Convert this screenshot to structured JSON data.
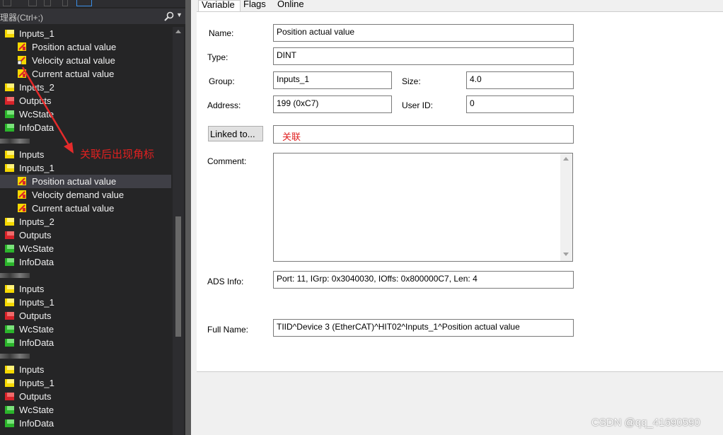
{
  "search": {
    "placeholder": "理器(Ctrl+;)"
  },
  "tree": [
    {
      "label": "Inputs_1",
      "icon": "yellow-folder-icon",
      "indent": 0
    },
    {
      "label": "Position actual value",
      "icon": "input-variable-icon",
      "indent": 1
    },
    {
      "label": "Velocity actual value",
      "icon": "linked-input-variable-icon",
      "indent": 1
    },
    {
      "label": "Current actual value",
      "icon": "input-variable-icon",
      "indent": 1
    },
    {
      "label": "Inputs_2",
      "icon": "yellow-folder-icon",
      "indent": 0
    },
    {
      "label": "Outputs",
      "icon": "red-folder-icon",
      "indent": 0
    },
    {
      "label": "WcState",
      "icon": "green-folder-icon",
      "indent": 0
    },
    {
      "label": "InfoData",
      "icon": "green-folder-icon",
      "indent": 0
    },
    {
      "label": "",
      "icon": "device-icon",
      "indent": -1
    },
    {
      "label": "Inputs",
      "icon": "yellow-folder-icon",
      "indent": 0
    },
    {
      "label": "Inputs_1",
      "icon": "yellow-folder-icon",
      "indent": 0
    },
    {
      "label": "Position actual value",
      "icon": "input-variable-icon",
      "indent": 1,
      "selected": true
    },
    {
      "label": "Velocity demand value",
      "icon": "input-variable-icon",
      "indent": 1
    },
    {
      "label": "Current actual value",
      "icon": "input-variable-icon",
      "indent": 1
    },
    {
      "label": "Inputs_2",
      "icon": "yellow-folder-icon",
      "indent": 0
    },
    {
      "label": "Outputs",
      "icon": "red-folder-icon",
      "indent": 0
    },
    {
      "label": "WcState",
      "icon": "green-folder-icon",
      "indent": 0
    },
    {
      "label": "InfoData",
      "icon": "green-folder-icon",
      "indent": 0
    },
    {
      "label": "",
      "icon": "device-icon",
      "indent": -1
    },
    {
      "label": "Inputs",
      "icon": "yellow-folder-icon",
      "indent": 0
    },
    {
      "label": "Inputs_1",
      "icon": "yellow-folder-icon",
      "indent": 0
    },
    {
      "label": "Outputs",
      "icon": "red-folder-icon",
      "indent": 0
    },
    {
      "label": "WcState",
      "icon": "green-folder-icon",
      "indent": 0
    },
    {
      "label": "InfoData",
      "icon": "green-folder-icon",
      "indent": 0
    },
    {
      "label": "",
      "icon": "device-icon",
      "indent": -1
    },
    {
      "label": "Inputs",
      "icon": "yellow-folder-icon",
      "indent": 0
    },
    {
      "label": "Inputs_1",
      "icon": "yellow-folder-icon",
      "indent": 0
    },
    {
      "label": "Outputs",
      "icon": "red-folder-icon",
      "indent": 0
    },
    {
      "label": "WcState",
      "icon": "green-folder-icon",
      "indent": 0
    },
    {
      "label": "InfoData",
      "icon": "green-folder-icon",
      "indent": 0
    }
  ],
  "tabs": [
    "Variable",
    "Flags",
    "Online"
  ],
  "form": {
    "name_label": "Name:",
    "name_value": "Position actual value",
    "type_label": "Type:",
    "type_value": "DINT",
    "group_label": "Group:",
    "group_value": "Inputs_1",
    "size_label": "Size:",
    "size_value": "4.0",
    "address_label": "Address:",
    "address_value": "199 (0xC7)",
    "userid_label": "User ID:",
    "userid_value": "0",
    "linked_button": "Linked to...",
    "linked_value": "关联",
    "comment_label": "Comment:",
    "comment_value": "",
    "ads_label": "ADS Info:",
    "ads_value": "Port: 11, IGrp: 0x3040030, IOffs: 0x800000C7, Len: 4",
    "fullname_label": "Full Name:",
    "fullname_value": "TIID^Device 3 (EtherCAT)^HIT02^Inputs_1^Position actual value"
  },
  "annotation": "关联后出现角标",
  "watermark": "CSDN @qq_41690590",
  "colors": {
    "annotation": "#e02020",
    "tree_bg": "#252526",
    "selected_row": "#3f3f46",
    "yellow": "#f5d800",
    "red": "#d8232a",
    "green": "#2bb52b"
  }
}
